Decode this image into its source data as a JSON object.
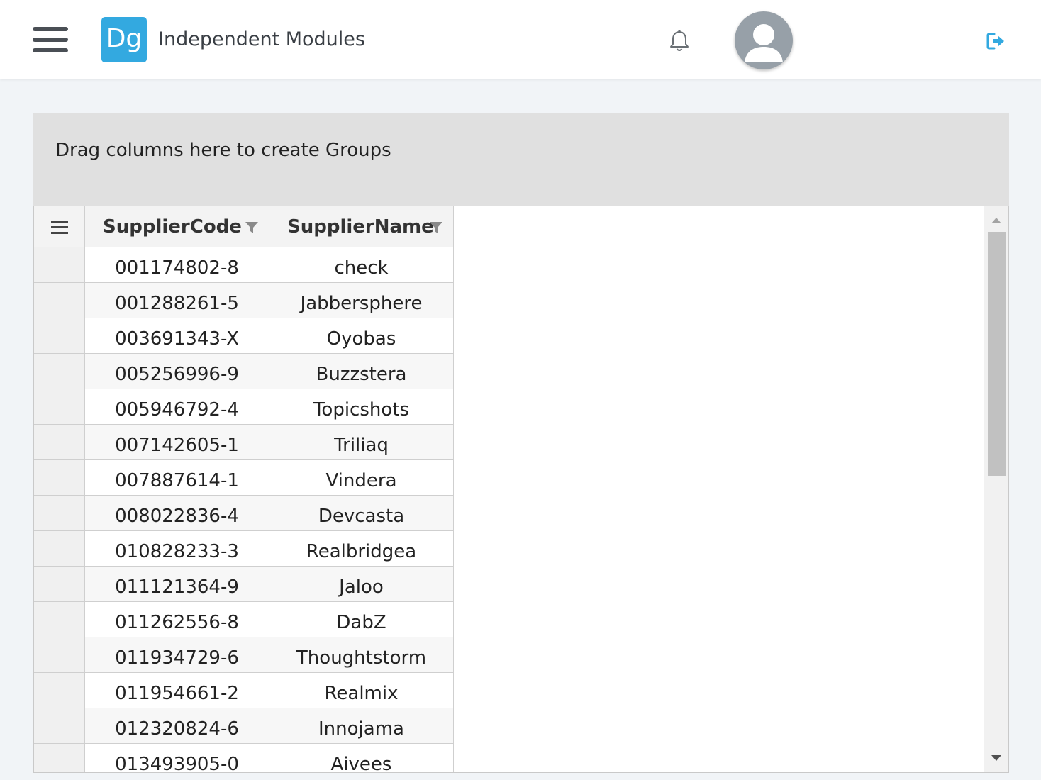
{
  "header": {
    "logo_text": "Dg",
    "app_title": "Independent Modules",
    "accent_color": "#33a9e0",
    "icons": [
      "hamburger-menu-icon",
      "bell-icon",
      "user-avatar-icon",
      "logout-icon"
    ]
  },
  "group_panel": {
    "hint": "Drag columns here to create Groups"
  },
  "grid": {
    "columns": [
      {
        "key": "supplier_code",
        "label": "SupplierCode"
      },
      {
        "key": "supplier_name",
        "label": "SupplierName"
      }
    ],
    "rows": [
      {
        "supplier_code": "001174802-8",
        "supplier_name": "check"
      },
      {
        "supplier_code": "001288261-5",
        "supplier_name": "Jabbersphere"
      },
      {
        "supplier_code": "003691343-X",
        "supplier_name": "Oyobas"
      },
      {
        "supplier_code": "005256996-9",
        "supplier_name": "Buzzstera"
      },
      {
        "supplier_code": "005946792-4",
        "supplier_name": "Topicshots"
      },
      {
        "supplier_code": "007142605-1",
        "supplier_name": "Triliaq"
      },
      {
        "supplier_code": "007887614-1",
        "supplier_name": "Vindera"
      },
      {
        "supplier_code": "008022836-4",
        "supplier_name": "Devcasta"
      },
      {
        "supplier_code": "010828233-3",
        "supplier_name": "Realbridgea"
      },
      {
        "supplier_code": "011121364-9",
        "supplier_name": "Jaloo"
      },
      {
        "supplier_code": "011262556-8",
        "supplier_name": "DabZ"
      },
      {
        "supplier_code": "011934729-6",
        "supplier_name": "Thoughtstorm"
      },
      {
        "supplier_code": "011954661-2",
        "supplier_name": "Realmix"
      },
      {
        "supplier_code": "012320824-6",
        "supplier_name": "Innojama"
      },
      {
        "supplier_code": "013493905-0",
        "supplier_name": "Aivees"
      }
    ]
  }
}
